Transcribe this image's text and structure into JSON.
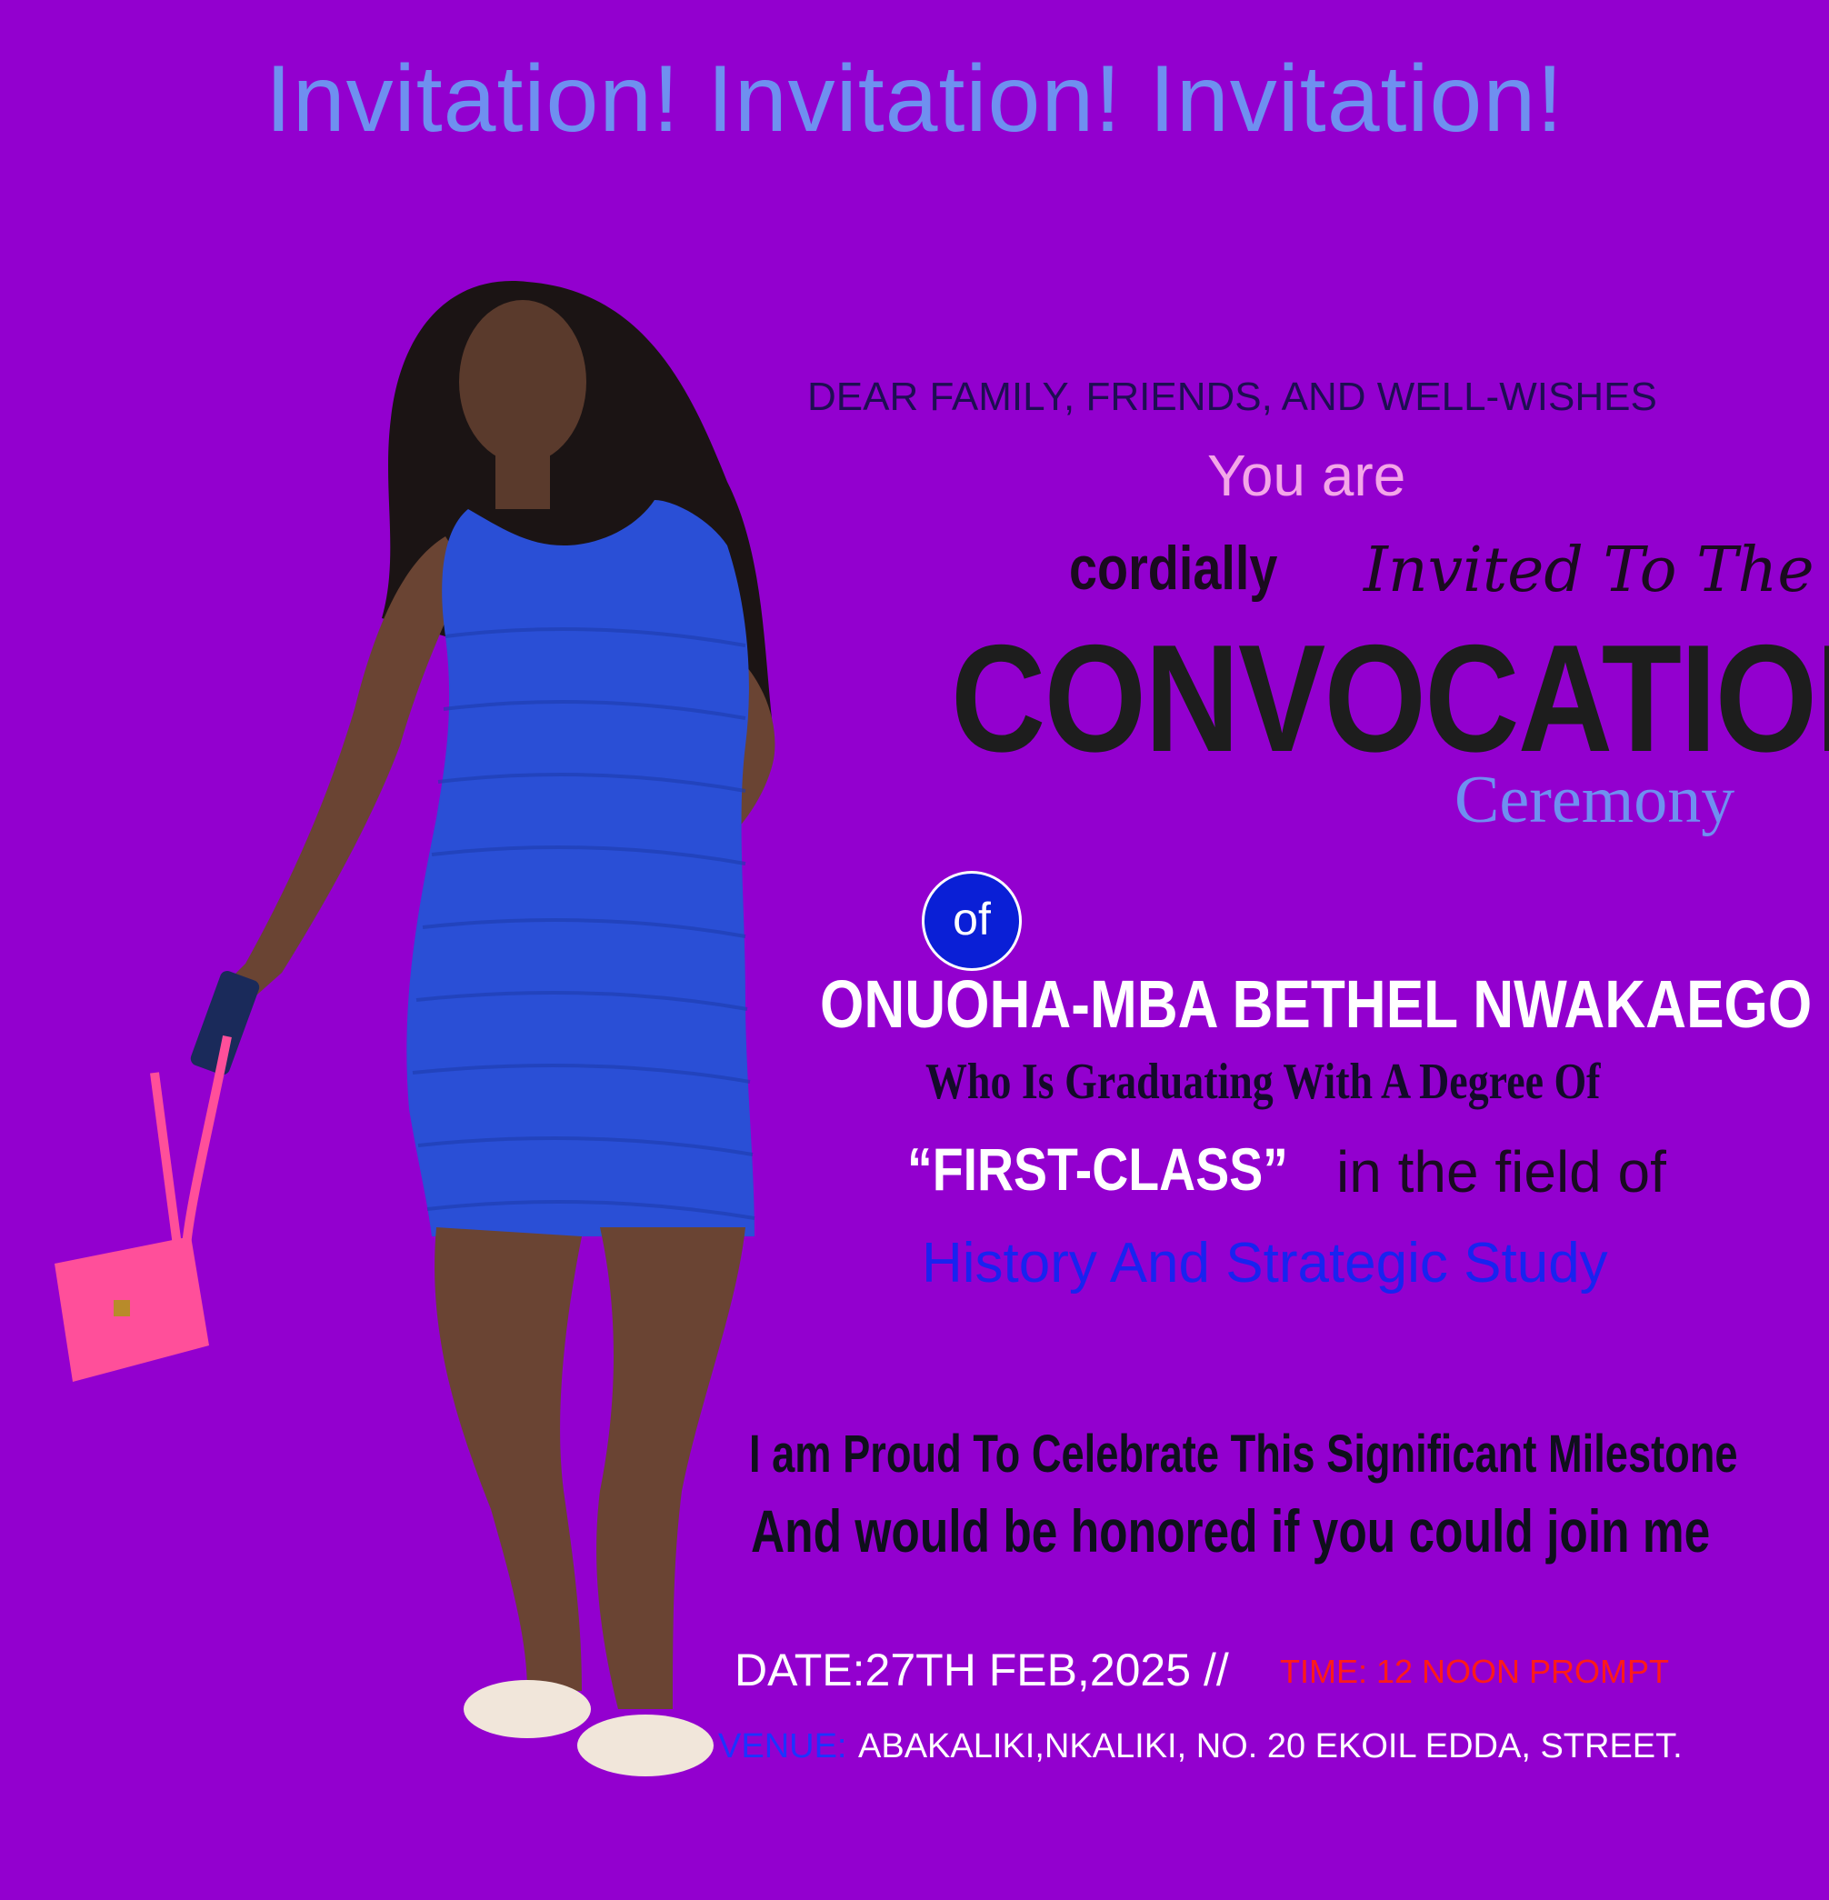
{
  "header": "Invitation! Invitation! Invitation!",
  "salutation": "DEAR FAMILY, FRIENDS, AND WELL-WISHES",
  "you_are": "You are",
  "cordially": "cordially",
  "invited_to_the": "Invited To The",
  "event": "CONVOCATION",
  "event_sub": "Ceremony",
  "of_badge": "of",
  "graduate_name": "ONUOHA-MBA BETHEL NWAKAEGO",
  "graduating_line": "Who Is Graduating With A Degree Of",
  "degree": "“FIRST-CLASS”",
  "field_intro": "in the field of",
  "field": "History And Strategic Study",
  "celebrate_line": "I am Proud To Celebrate This Significant Milestone",
  "join_line": "And would be honored if you could join me",
  "date": "DATE:27TH FEB,2025 //",
  "time": "TIME: 12 NOON PROMPT",
  "venue_label": "VENUE:",
  "venue": "ABAKALIKI,NKALIKI,  NO. 20 EKOIL EDDA, STREET.",
  "colors": {
    "background": "#9300cf",
    "header": "#6f8ff0",
    "dress": "#2a4fd6",
    "bag": "#ff4f9a",
    "time": "#ff1a1a",
    "field": "#1922f0"
  }
}
